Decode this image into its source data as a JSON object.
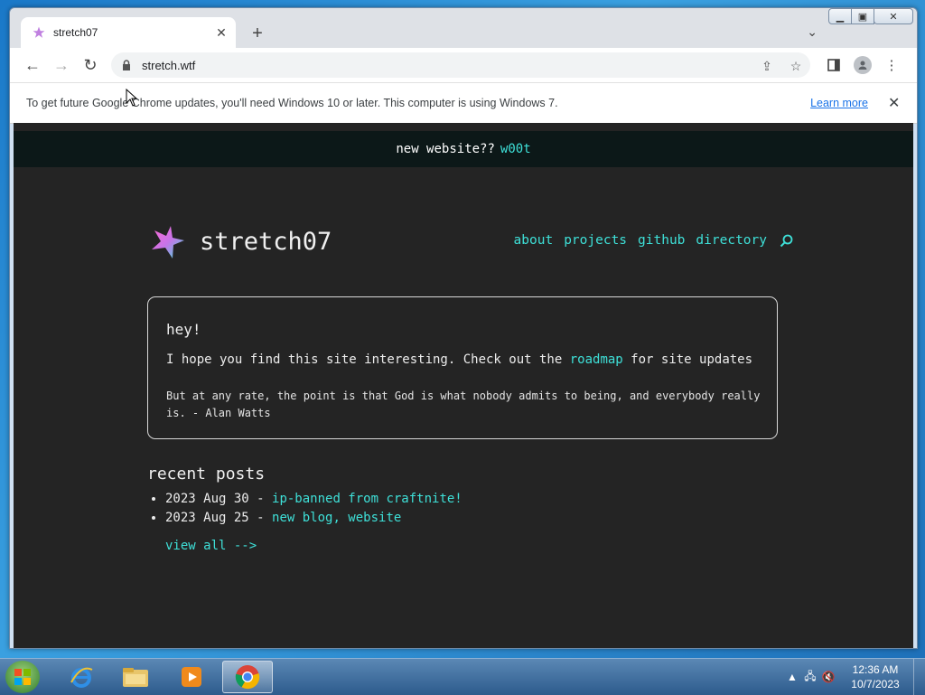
{
  "browser": {
    "tab": {
      "title": "stretch07"
    },
    "url": "stretch.wtf",
    "infobar": {
      "message": "To get future Google Chrome updates, you'll need Windows 10 or later. This computer is using Windows 7.",
      "learn_more": "Learn more"
    }
  },
  "site": {
    "banner": {
      "text": "new website??",
      "accent": "w00t"
    },
    "title": "stretch07",
    "nav": [
      "about",
      "projects",
      "github",
      "directory"
    ],
    "card": {
      "heading": "hey!",
      "intro_before": "I hope you find this site interesting. Check out the ",
      "intro_link": "roadmap",
      "intro_after": " for site updates",
      "quote": "But at any rate, the point is that God is what nobody admits to being, and everybody really is. - Alan Watts"
    },
    "recent": {
      "title": "recent posts",
      "posts": [
        {
          "date": "2023 Aug 30",
          "title": "ip-banned from craftnite!"
        },
        {
          "date": "2023 Aug 25",
          "title": "new blog, website"
        }
      ],
      "view_all": "view all -->"
    }
  },
  "taskbar": {
    "clock": {
      "time": "12:36 AM",
      "date": "10/7/2023"
    }
  },
  "colors": {
    "accent": "#3ee0d8",
    "page_bg": "#242424",
    "banner_bg": "#0c1818"
  }
}
